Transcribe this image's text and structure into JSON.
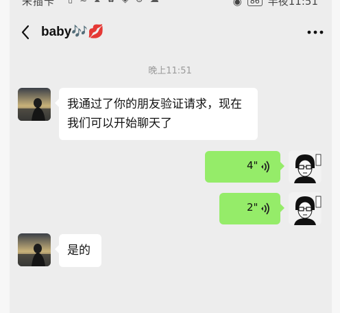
{
  "status_bar": {
    "carrier": "未插卡",
    "battery": "86",
    "time": "半夜11:51"
  },
  "header": {
    "title": "baby🎶💋"
  },
  "messages": [
    {
      "type": "timestamp",
      "text": "晚上11:51"
    },
    {
      "type": "text",
      "side": "left",
      "lines": [
        "我通过了你的朋友验证请求，现在",
        "我们可以开始聊天了"
      ]
    },
    {
      "type": "voice",
      "side": "right",
      "duration": "4\""
    },
    {
      "type": "voice",
      "side": "right",
      "duration": "2\""
    },
    {
      "type": "text",
      "side": "left",
      "lines": [
        "是的"
      ]
    }
  ],
  "colors": {
    "chat_background": "#ededed",
    "sent_bubble": "#95ec69",
    "received_bubble": "#ffffff"
  }
}
